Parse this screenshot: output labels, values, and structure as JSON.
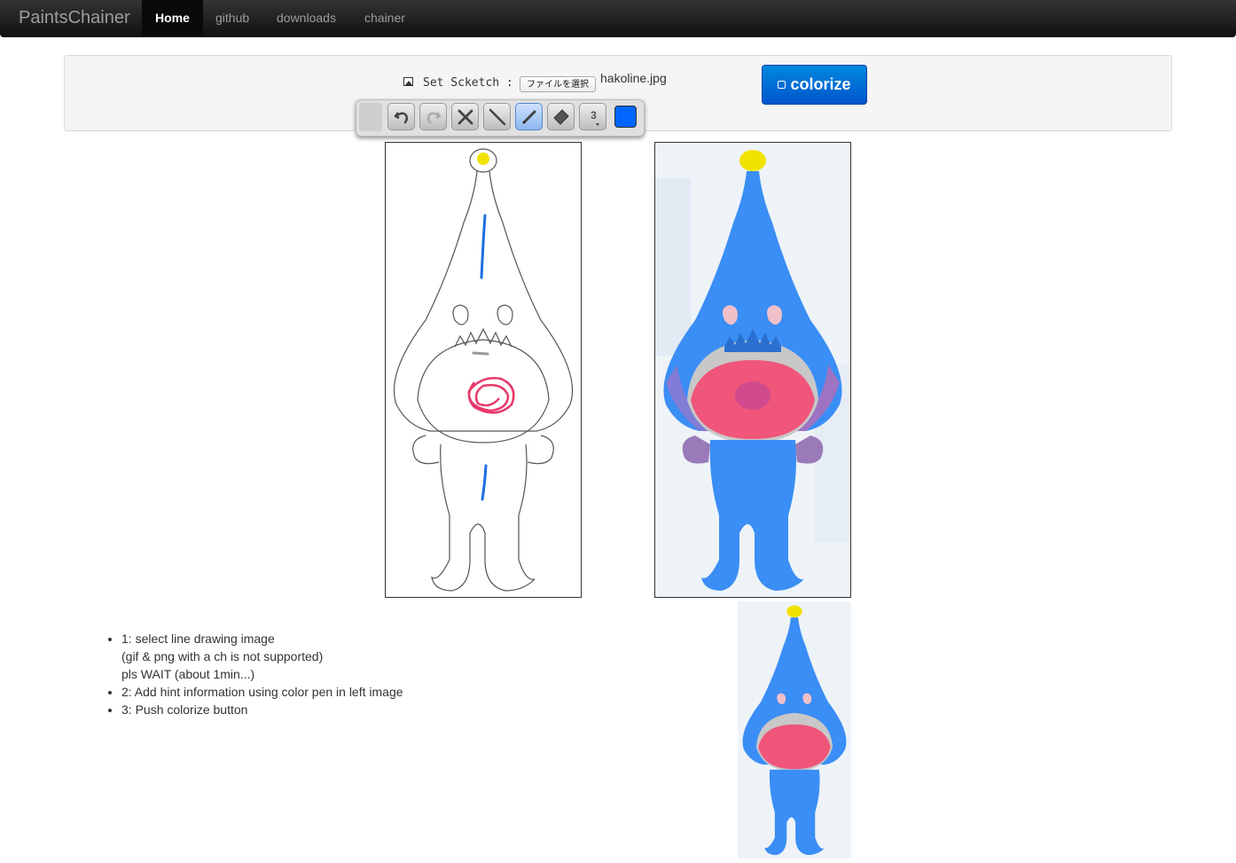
{
  "navbar": {
    "brand": "PaintsChainer",
    "items": [
      "Home",
      "github",
      "downloads",
      "chainer"
    ]
  },
  "form": {
    "sketch_label": "Set Scketch :",
    "file_button": "ファイルを選択",
    "file_name": "hakoline.jpg",
    "colorize_label": "colorize"
  },
  "toolbar": {
    "tools": [
      "undo-icon",
      "redo-icon",
      "clear-icon",
      "line-icon",
      "pen-icon",
      "eraser-icon"
    ],
    "active_tool": "pen-icon",
    "brush_size": "3",
    "pen_color": "#0066ff"
  },
  "instructions": [
    {
      "line1": "1: select line drawing image",
      "line2": "(gif & png with a ch is not supported)",
      "line3": "pls WAIT (about 1min...)"
    },
    {
      "line1": "2: Add hint information using color pen in left image"
    },
    {
      "line1": "3: Push colorize button"
    }
  ],
  "colors": {
    "accent": "#0066ff",
    "hint_blue": "#1e6fe0",
    "hint_red": "#e8386a",
    "hint_yellow": "#f2e200",
    "hint_gray": "#999999",
    "colorized_body": "#3a8ef5",
    "colorized_mouth": "#f0557a"
  }
}
